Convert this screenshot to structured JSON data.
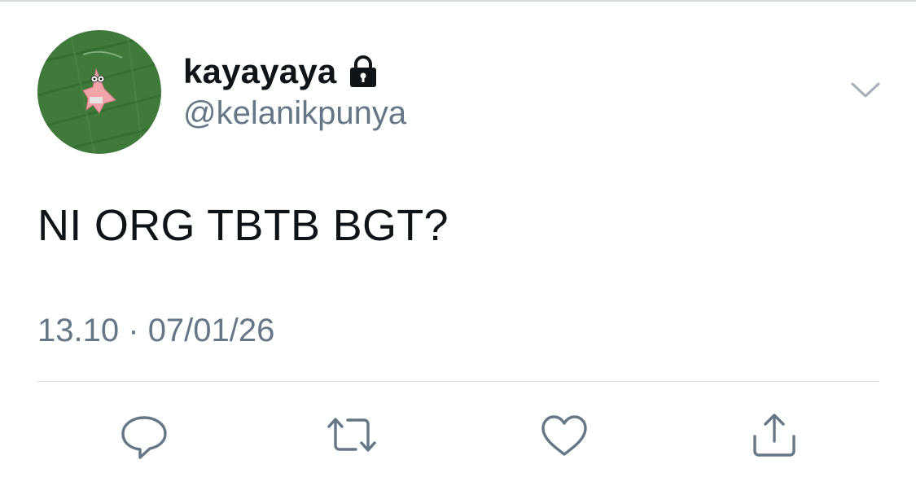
{
  "tweet": {
    "author": {
      "display_name": "kayayaya",
      "handle": "@kelanikpunya",
      "protected_icon": "lock-icon",
      "avatar": "green-background-starfish-avatar"
    },
    "text": "NI ORG TBTB BGT?",
    "time": "13.10",
    "separator": "·",
    "date": "07/01/26",
    "menu_icon": "chevron-down-icon"
  },
  "actions": [
    {
      "name": "reply",
      "icon": "speech-bubble-icon"
    },
    {
      "name": "retweet",
      "icon": "retweet-icon"
    },
    {
      "name": "like",
      "icon": "heart-icon"
    },
    {
      "name": "share",
      "icon": "share-upload-icon"
    }
  ],
  "colors": {
    "text": "#0f1419",
    "secondary": "#657786",
    "divider": "#d7dce0",
    "avatar_bg": "#3f7a3a",
    "icon": "#657786"
  }
}
